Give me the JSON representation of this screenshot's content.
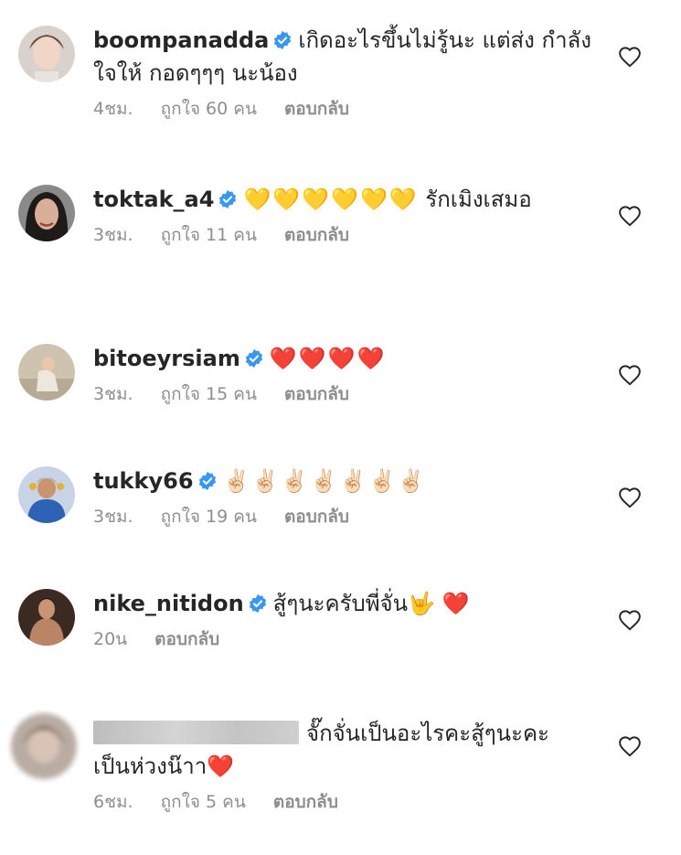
{
  "comments": [
    {
      "username": "boompanadda",
      "text": "เกิดอะไรขึ้นไม่รู้นะ แต่ส่ง กำลังใจให้ กอดๆๆๆ นะน้อง",
      "time": "4ชม.",
      "likes": "ถูกใจ 60 คน",
      "reply": "ตอบกลับ"
    },
    {
      "username": "toktak_a4",
      "emojis": "💛💛💛💛💛💛",
      "text": " รักเมิงเสมอ",
      "time": "3ชม.",
      "likes": "ถูกใจ 11 คน",
      "reply": "ตอบกลับ"
    },
    {
      "username": "bitoeyrsiam",
      "emojis": "❤️❤️❤️❤️",
      "time": "3ชม.",
      "likes": "ถูกใจ 15 คน",
      "reply": "ตอบกลับ"
    },
    {
      "username": "tukky66",
      "emojis": "✌🏻✌🏻✌🏻✌🏻✌🏻✌🏻✌🏻",
      "time": "3ชม.",
      "likes": "ถูกใจ 19 คน",
      "reply": "ตอบกลับ"
    },
    {
      "username": "nike_nitidon",
      "text": "สู้ๆนะครับพี่จั่น",
      "emojis": "🤟 ❤️",
      "time": "20น",
      "reply": "ตอบกลับ"
    },
    {
      "text": "จั๊กจั่นเป็นอะไรคะสู้ๆนะคะ เป็นห่วงน๊าา",
      "emojis": "❤️",
      "time": "6ชม.",
      "likes": "ถูกใจ 5 คน",
      "reply": "ตอบกลับ"
    }
  ],
  "icons": {
    "like": "heart-outline-icon",
    "verified": "verified-badge-icon"
  },
  "colors": {
    "text": "#262626",
    "meta": "#8e8e8e",
    "verified": "#3897f0"
  }
}
